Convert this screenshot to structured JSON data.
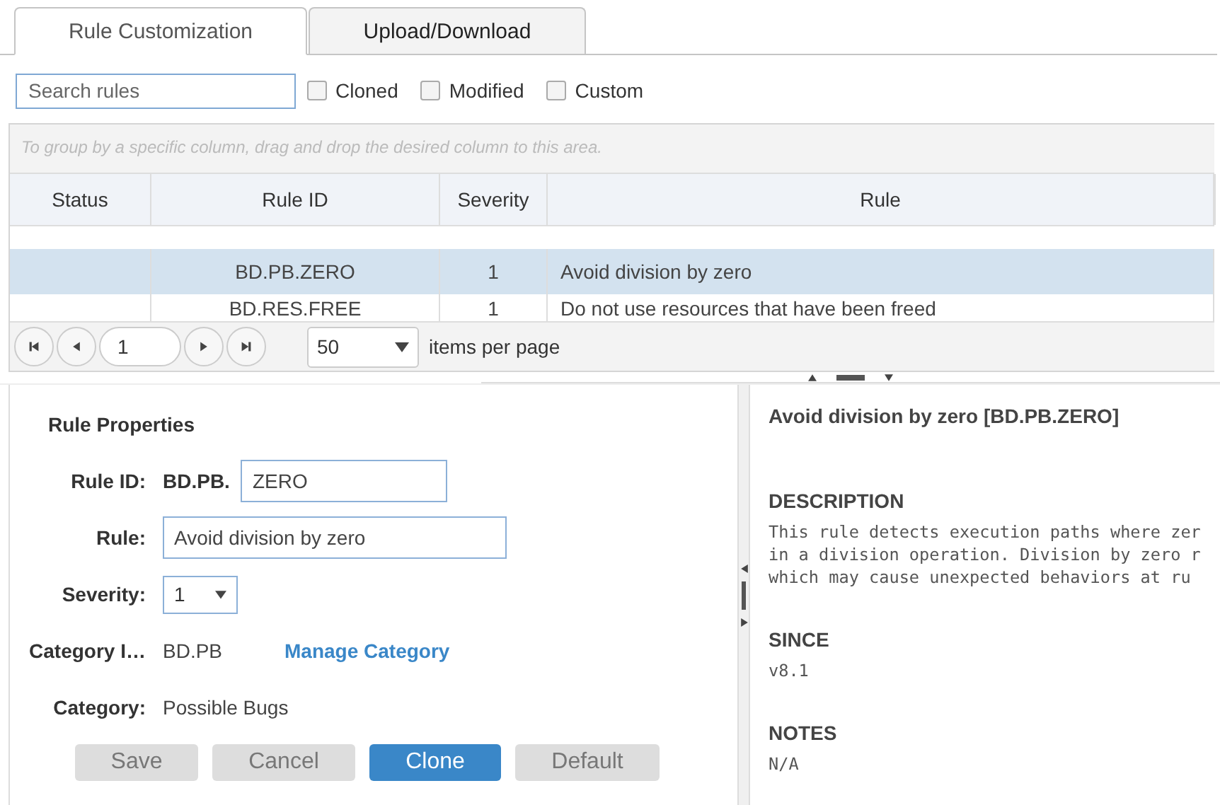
{
  "tabs": [
    {
      "label": "Rule Customization",
      "selected": true
    },
    {
      "label": "Upload/Download",
      "selected": false
    }
  ],
  "search": {
    "placeholder": "Search rules"
  },
  "filters": [
    {
      "label": "Cloned",
      "checked": false
    },
    {
      "label": "Modified",
      "checked": false
    },
    {
      "label": "Custom",
      "checked": false
    }
  ],
  "grid": {
    "group_hint": "To group by a specific column, drag and drop the desired column to this area.",
    "columns": [
      "Status",
      "Rule ID",
      "Severity",
      "Rule"
    ],
    "rows": [
      {
        "status": "",
        "rule_id": "BD.PB.ZERO",
        "severity": "1",
        "rule": "Avoid division by zero",
        "selected": true
      },
      {
        "status": "",
        "rule_id": "BD.RES.FREE",
        "severity": "1",
        "rule": "Do not use resources that have been freed",
        "selected": false
      }
    ]
  },
  "pager": {
    "page": "1",
    "page_size": "50",
    "label": "items per page"
  },
  "properties": {
    "title": "Rule Properties",
    "rule_id_label": "Rule ID:",
    "rule_id_prefix": "BD.PB.",
    "rule_id_value": "ZERO",
    "rule_label": "Rule:",
    "rule_value": "Avoid division by zero",
    "severity_label": "Severity:",
    "severity_value": "1",
    "category_id_label": "Category I…",
    "category_id_value": "BD.PB",
    "manage_link": "Manage Category",
    "category_label": "Category:",
    "category_value": "Possible Bugs"
  },
  "buttons": [
    {
      "label": "Save",
      "kind": "default",
      "disabled": true
    },
    {
      "label": "Cancel",
      "kind": "default",
      "disabled": true
    },
    {
      "label": "Clone",
      "kind": "primary",
      "disabled": false
    },
    {
      "label": "Default",
      "kind": "default",
      "disabled": true
    }
  ],
  "doc": {
    "title": "Avoid division by zero [BD.PB.ZERO]",
    "sections": [
      {
        "heading": "DESCRIPTION",
        "lines": [
          "This rule detects execution paths where zer",
          "in a division operation. Division by zero r",
          "which may cause unexpected behaviors at ru"
        ]
      },
      {
        "heading": "SINCE",
        "lines": [
          "v8.1"
        ]
      },
      {
        "heading": "NOTES",
        "lines": [
          "N/A"
        ]
      }
    ]
  }
}
